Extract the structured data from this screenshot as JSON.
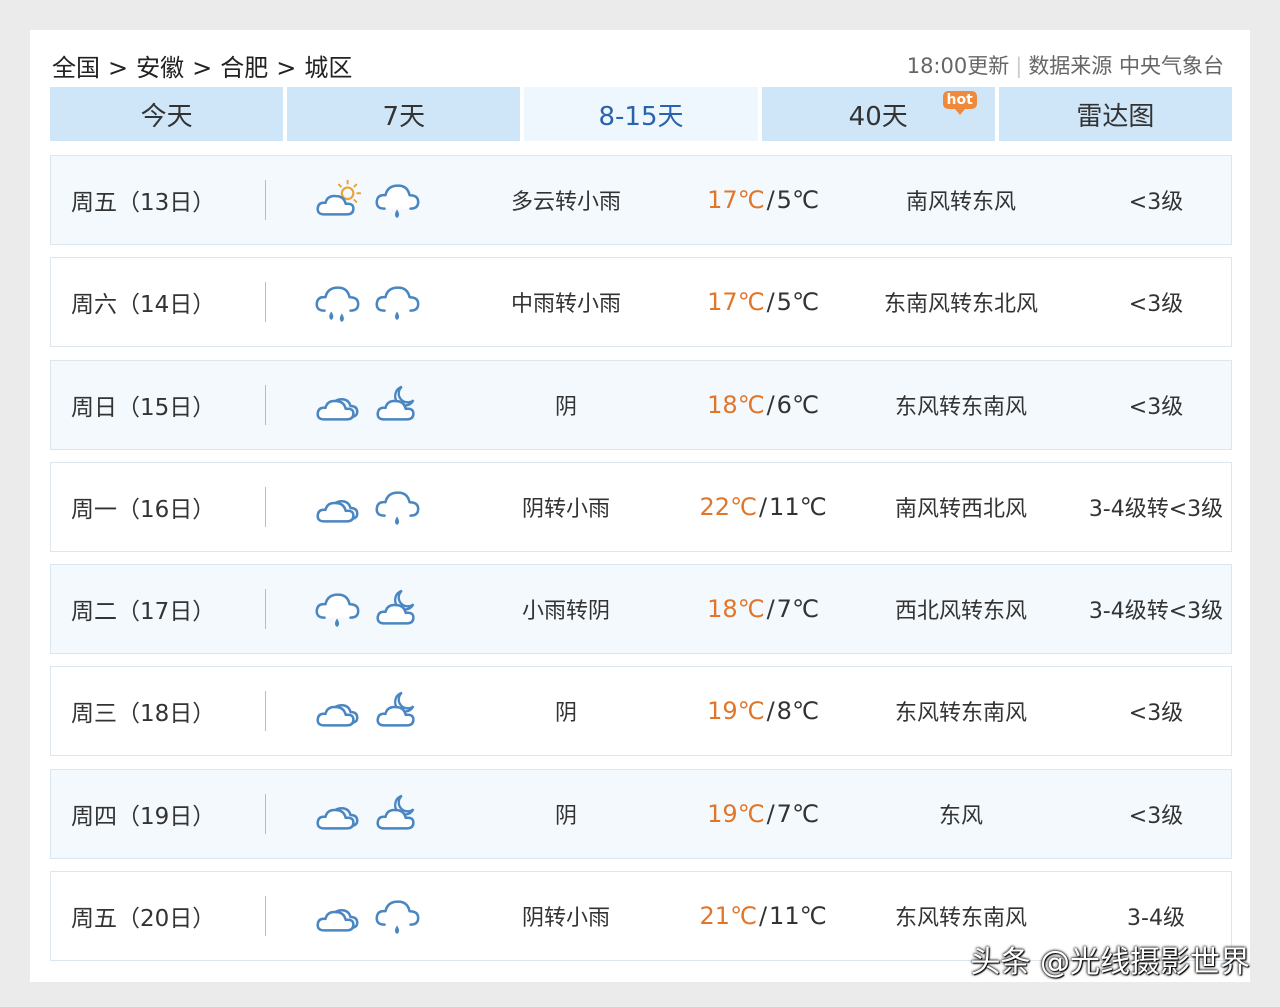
{
  "breadcrumb": [
    "全国",
    "安徽",
    "合肥",
    "城区"
  ],
  "breadcrumb_separator": ">",
  "meta": {
    "update_time": "18:00更新",
    "divider": "|",
    "source": "数据来源 中央气象台"
  },
  "tabs": [
    {
      "label": "今天"
    },
    {
      "label": "7天"
    },
    {
      "label": "8-15天"
    },
    {
      "label": "40天"
    },
    {
      "label": "雷达图"
    }
  ],
  "hot_badge": "hot",
  "colors": {
    "tab_bg": "#cfe6f8",
    "tab_active_bg": "#eef7fd",
    "tab_active_text": "#2a63ad",
    "high_temp": "#e0762a",
    "icon_stroke": "#4a86c2",
    "sun": "#f0a030"
  },
  "days": [
    {
      "date": "周五（13日）",
      "icon1": "partly-cloudy-day-icon",
      "icon2": "light-rain-icon",
      "desc": "多云转小雨",
      "high": "17℃",
      "low": "5℃",
      "wind": "南风转东风",
      "level": "<3级"
    },
    {
      "date": "周六（14日）",
      "icon1": "moderate-rain-icon",
      "icon2": "light-rain-icon",
      "desc": "中雨转小雨",
      "high": "17℃",
      "low": "5℃",
      "wind": "东南风转东北风",
      "level": "<3级"
    },
    {
      "date": "周日（15日）",
      "icon1": "overcast-icon",
      "icon2": "cloudy-night-icon",
      "desc": "阴",
      "high": "18℃",
      "low": "6℃",
      "wind": "东风转东南风",
      "level": "<3级"
    },
    {
      "date": "周一（16日）",
      "icon1": "overcast-icon",
      "icon2": "light-rain-icon",
      "desc": "阴转小雨",
      "high": "22℃",
      "low": "11℃",
      "wind": "南风转西北风",
      "level": "3-4级转<3级"
    },
    {
      "date": "周二（17日）",
      "icon1": "light-rain-icon",
      "icon2": "cloudy-night-icon",
      "desc": "小雨转阴",
      "high": "18℃",
      "low": "7℃",
      "wind": "西北风转东风",
      "level": "3-4级转<3级"
    },
    {
      "date": "周三（18日）",
      "icon1": "overcast-icon",
      "icon2": "cloudy-night-icon",
      "desc": "阴",
      "high": "19℃",
      "low": "8℃",
      "wind": "东风转东南风",
      "level": "<3级"
    },
    {
      "date": "周四（19日）",
      "icon1": "overcast-icon",
      "icon2": "cloudy-night-icon",
      "desc": "阴",
      "high": "19℃",
      "low": "7℃",
      "wind": "东风",
      "level": "<3级"
    },
    {
      "date": "周五（20日）",
      "icon1": "overcast-icon",
      "icon2": "light-rain-icon",
      "desc": "阴转小雨",
      "high": "21℃",
      "low": "11℃",
      "wind": "东风转东南风",
      "level": "3-4级"
    }
  ],
  "watermark": "头条 @光线摄影世界"
}
